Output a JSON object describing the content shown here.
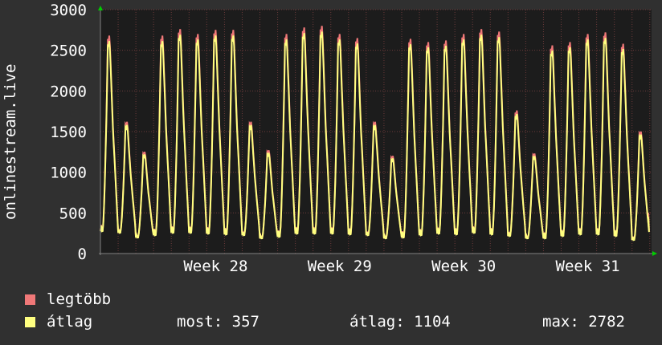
{
  "chart_data": {
    "type": "line",
    "ylabel": "onlinestream.live",
    "ylim": [
      0,
      3000
    ],
    "yticks": [
      0,
      500,
      1000,
      1500,
      2000,
      2500,
      3000
    ],
    "xticks": [
      "Week 28",
      "Week 29",
      "Week 30",
      "Week 31"
    ],
    "grid": true,
    "colors": {
      "background": "#303030",
      "plot": "#1c1c1c",
      "grid": "#6b3a3a",
      "max_line": "#f07878",
      "avg_line": "#ffff80",
      "axis_arrow": "#00cc00"
    },
    "daily_peaks": [
      2680,
      1620,
      1250,
      2680,
      2760,
      2700,
      2750,
      2750,
      1620,
      1270,
      2700,
      2780,
      2800,
      2700,
      2650,
      1620,
      1200,
      2640,
      2600,
      2620,
      2700,
      2760,
      2730,
      1760,
      1230,
      2560,
      2600,
      2700,
      2720,
      2580,
      1500
    ],
    "daily_troughs": [
      280,
      260,
      200,
      230,
      260,
      260,
      250,
      240,
      230,
      190,
      210,
      250,
      250,
      250,
      240,
      230,
      190,
      200,
      230,
      250,
      240,
      260,
      240,
      220,
      190,
      190,
      220,
      240,
      240,
      220,
      170
    ],
    "end_value": 500,
    "series": [
      {
        "name": "legtöbb",
        "color": "#f07878"
      },
      {
        "name": "átlag",
        "color": "#ffff80"
      }
    ]
  },
  "legend": {
    "max_label": "legtöbb",
    "avg_label": "átlag",
    "stat_now": "most: 357",
    "stat_avg": "átlag: 1104",
    "stat_max": "max: 2782"
  }
}
